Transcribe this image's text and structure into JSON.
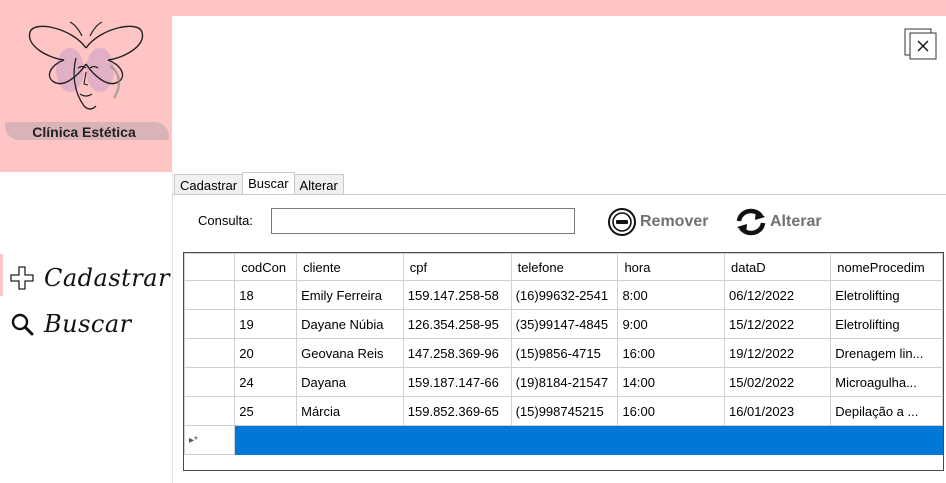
{
  "logo": {
    "title": "Clínica Estética"
  },
  "nav": [
    {
      "label": "Cadastrar",
      "icon": "plus-icon"
    },
    {
      "label": "Buscar",
      "icon": "search-icon"
    }
  ],
  "tabs": [
    {
      "label": "Cadastrar",
      "active": false
    },
    {
      "label": "Buscar",
      "active": true
    },
    {
      "label": "Alterar",
      "active": false
    }
  ],
  "search": {
    "label": "Consulta:",
    "value": ""
  },
  "buttons": {
    "remover": "Remover",
    "alterar": "Alterar"
  },
  "grid": {
    "columns": [
      "codCon",
      "cliente",
      "cpf",
      "telefone",
      "hora",
      "dataD",
      "nomeProcedim"
    ],
    "rows": [
      [
        "18",
        "Emily Ferreira",
        "159.147.258-58",
        "(16)99632-2541",
        "8:00",
        "06/12/2022",
        "Eletrolifting"
      ],
      [
        "19",
        "Dayane Núbia",
        "126.354.258-95",
        "(35)99147-4845",
        "9:00",
        "15/12/2022",
        "Eletrolifting"
      ],
      [
        "20",
        "Geovana Reis",
        "147.258.369-96",
        "(15)9856-4715",
        "16:00",
        "19/12/2022",
        "Drenagem lin..."
      ],
      [
        "24",
        "Dayana",
        "159.187.147-66",
        "(19)8184-21547",
        "14:00",
        "15/02/2022",
        "Microagulha..."
      ],
      [
        "25",
        "Márcia",
        "159.852.369-65",
        "(15)998745215",
        "16:00",
        "16/01/2023",
        "Depilação a ..."
      ]
    ],
    "new_row_marker": "▸*"
  },
  "colors": {
    "brand_pink": "#ffc4c4",
    "selection_blue": "#0078d7",
    "button_gray": "#707070"
  }
}
